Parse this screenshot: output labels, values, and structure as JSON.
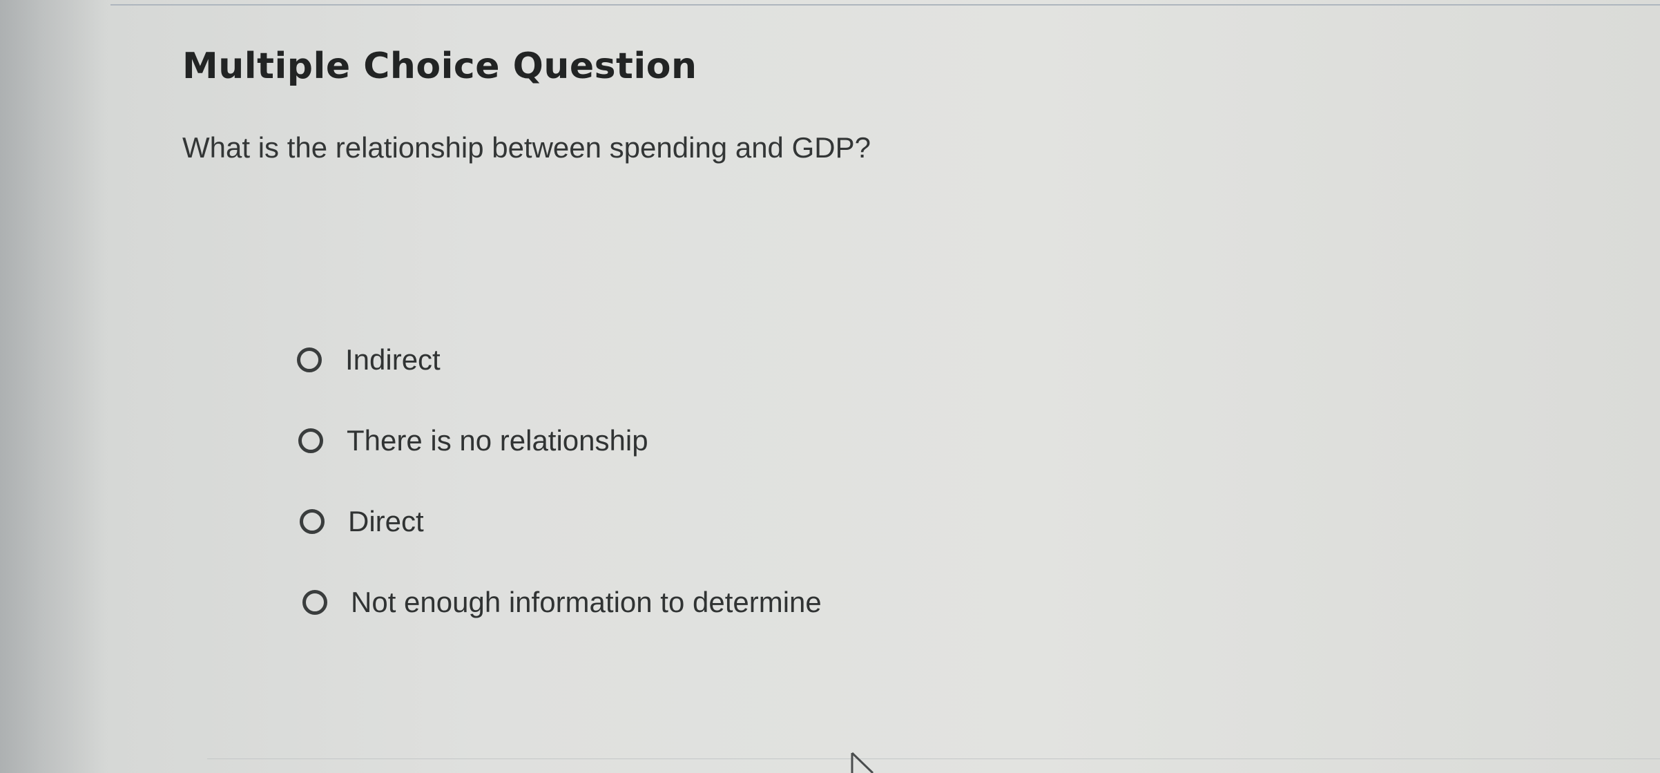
{
  "title": "Multiple Choice Question",
  "question": "What is the relationship between spending and GDP?",
  "options": [
    {
      "label": "Indirect",
      "selected": false
    },
    {
      "label": "There is no relationship",
      "selected": false
    },
    {
      "label": "Direct",
      "selected": false
    },
    {
      "label": "Not enough information to determine",
      "selected": false
    }
  ],
  "icons": {
    "radio": "radio-unselected-icon",
    "cursor": "pointer-cursor-icon"
  },
  "colors": {
    "text": "#303333",
    "background": "#e0e1df",
    "rule": "#aeb6be"
  }
}
